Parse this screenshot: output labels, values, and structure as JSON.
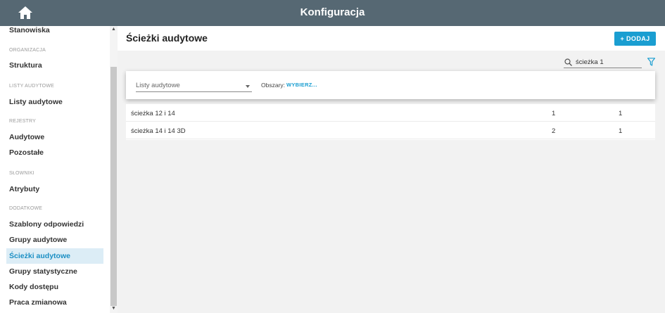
{
  "topbar": {
    "title": "Konfiguracja",
    "home_icon": "home-icon"
  },
  "sidebar": {
    "items": [
      {
        "label": "Stanowiska"
      },
      {
        "section": "ORGANIZACJA"
      },
      {
        "label": "Struktura"
      },
      {
        "section": "LISTY AUDYTOWE"
      },
      {
        "label": "Listy audytowe"
      },
      {
        "section": "REJESTRY"
      },
      {
        "label": "Audytowe"
      },
      {
        "label": "Pozostałe"
      },
      {
        "section": "SŁOWNIKI"
      },
      {
        "label": "Atrybuty"
      },
      {
        "section": "DODATKOWE"
      },
      {
        "label": "Szablony odpowiedzi"
      },
      {
        "label": "Grupy audytowe"
      },
      {
        "label": "Ścieżki audytowe",
        "active": true
      },
      {
        "label": "Grupy statystyczne"
      },
      {
        "label": "Kody dostępu"
      },
      {
        "label": "Praca zmianowa"
      }
    ]
  },
  "main": {
    "title": "Ścieżki audytowe",
    "add_label": "+ DODAJ",
    "search_value": "ścieżka 1",
    "filter": {
      "select_value": "Listy audytowe",
      "areas_label": "Obszary:",
      "areas_link": "WYBIERZ..."
    },
    "rows": [
      {
        "name": "ścieżka 12 i 14",
        "col1": "1",
        "col2": "1"
      },
      {
        "name": "ścieżka 14 i 14 3D",
        "col1": "2",
        "col2": "1"
      }
    ]
  },
  "colors": {
    "topbar": "#566873",
    "accent": "#1a9ed1",
    "active_bg": "#dcedf6"
  }
}
